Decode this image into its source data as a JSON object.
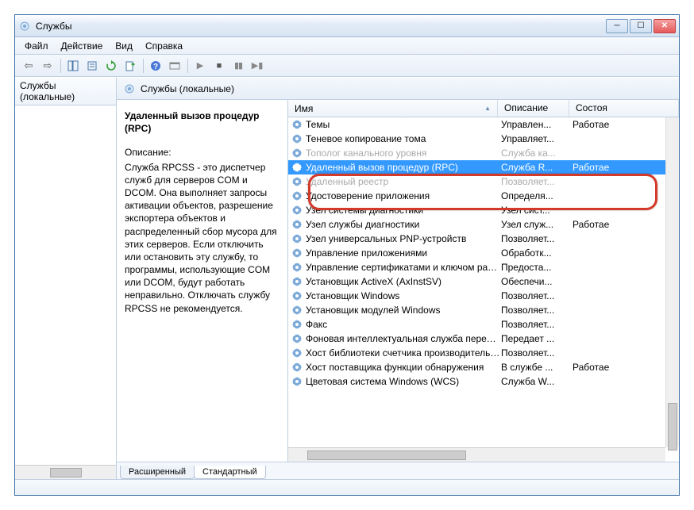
{
  "window": {
    "title": "Службы"
  },
  "menu": [
    "Файл",
    "Действие",
    "Вид",
    "Справка"
  ],
  "tree": {
    "header": "Службы (локальные)",
    "item": ""
  },
  "main_header": "Службы (локальные)",
  "detail": {
    "title": "Удаленный вызов процедур (RPC)",
    "desc_label": "Описание:",
    "desc_body": "Служба RPCSS - это диспетчер служб для серверов COM и DCOM. Она выполняет запросы активации объектов, разрешение экспортера объектов и распределенный сбор мусора для этих серверов. Если отключить или остановить эту службу, то программы, использующие COM или DCOM, будут работать неправильно. Отключать службу RPCSS не рекомендуется."
  },
  "columns": {
    "name": "Имя",
    "desc": "Описание",
    "status": "Состоя"
  },
  "services": [
    {
      "name": "Темы",
      "desc": "Управлен...",
      "status": "Работае",
      "sel": false,
      "faded": false
    },
    {
      "name": "Теневое копирование тома",
      "desc": "Управляет...",
      "status": "",
      "sel": false,
      "faded": false
    },
    {
      "name": "Тополог канального уровня",
      "desc": "Служба ка...",
      "status": "",
      "sel": false,
      "faded": true
    },
    {
      "name": "Удаленный вызов процедур (RPC)",
      "desc": "Служба R...",
      "status": "Работае",
      "sel": true,
      "faded": false
    },
    {
      "name": "Удаленный реестр",
      "desc": "Позволяет...",
      "status": "",
      "sel": false,
      "faded": true
    },
    {
      "name": "Удостоверение приложения",
      "desc": "Определя...",
      "status": "",
      "sel": false,
      "faded": false
    },
    {
      "name": "Узел системы диагностики",
      "desc": "Узел сист...",
      "status": "",
      "sel": false,
      "faded": false
    },
    {
      "name": "Узел службы диагностики",
      "desc": "Узел служ...",
      "status": "Работае",
      "sel": false,
      "faded": false
    },
    {
      "name": "Узел универсальных PNP-устройств",
      "desc": "Позволяет...",
      "status": "",
      "sel": false,
      "faded": false
    },
    {
      "name": "Управление приложениями",
      "desc": "Обработк...",
      "status": "",
      "sel": false,
      "faded": false
    },
    {
      "name": "Управление сертификатами и ключом работосп...",
      "desc": "Предоста...",
      "status": "",
      "sel": false,
      "faded": false
    },
    {
      "name": "Установщик ActiveX (AxInstSV)",
      "desc": "Обеспечи...",
      "status": "",
      "sel": false,
      "faded": false
    },
    {
      "name": "Установщик Windows",
      "desc": "Позволяет...",
      "status": "",
      "sel": false,
      "faded": false
    },
    {
      "name": "Установщик модулей Windows",
      "desc": "Позволяет...",
      "status": "",
      "sel": false,
      "faded": false
    },
    {
      "name": "Факс",
      "desc": "Позволяет...",
      "status": "",
      "sel": false,
      "faded": false
    },
    {
      "name": "Фоновая интеллектуальная служба передачи (BI...",
      "desc": "Передает ...",
      "status": "",
      "sel": false,
      "faded": false
    },
    {
      "name": "Хост библиотеки счетчика производительности",
      "desc": "Позволяет...",
      "status": "",
      "sel": false,
      "faded": false
    },
    {
      "name": "Хост поставщика функции обнаружения",
      "desc": "В службе ...",
      "status": "Работае",
      "sel": false,
      "faded": false
    },
    {
      "name": "Цветовая система Windows (WCS)",
      "desc": "Служба W...",
      "status": "",
      "sel": false,
      "faded": false
    }
  ],
  "tabs": {
    "extended": "Расширенный",
    "standard": "Стандартный"
  }
}
